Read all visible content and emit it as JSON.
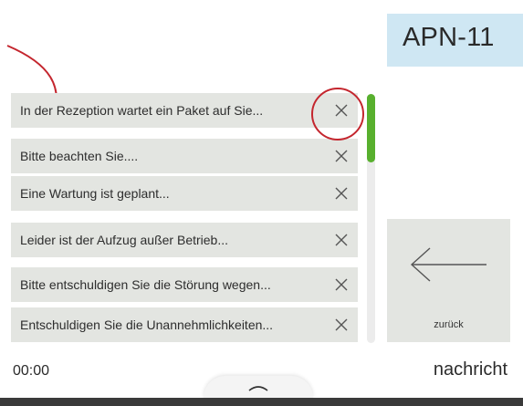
{
  "device_tag": "APN-11",
  "messages": [
    {
      "label": "In der Rezeption wartet ein Paket auf Sie..."
    },
    {
      "label": "Bitte beachten Sie...."
    },
    {
      "label": "Eine Wartung ist geplant..."
    },
    {
      "label": "Leider ist der Aufzug außer Betrieb..."
    },
    {
      "label": "Bitte entschuldigen Sie die Störung wegen..."
    },
    {
      "label": "Entschuldigen Sie die Unannehmlichkeiten..."
    }
  ],
  "back_button": {
    "label": "zurück",
    "icon": "arrow-left-icon"
  },
  "footer": {
    "time": "00:00",
    "mode": "nachricht"
  },
  "drawer": {
    "icon": "chevron-up-icon"
  },
  "scroll": {
    "position": 0
  },
  "colors": {
    "row_bg": "#e3e5e1",
    "tag_bg": "#cfe7f3",
    "scroll_thumb": "#58b02e",
    "annotation": "#c4262e"
  }
}
